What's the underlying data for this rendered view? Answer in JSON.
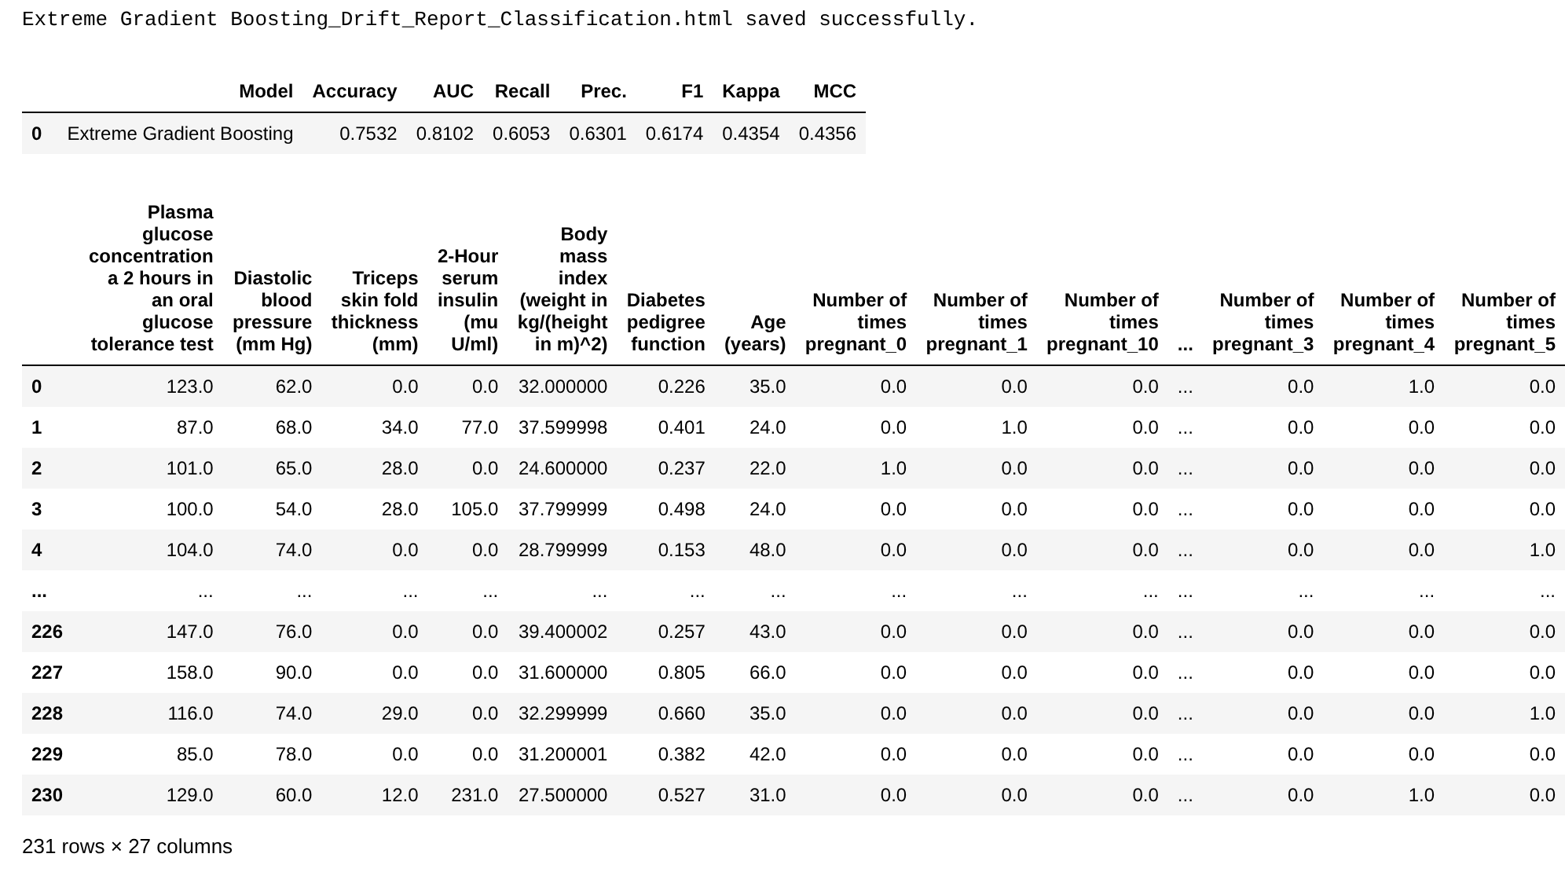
{
  "output_message": "Extreme Gradient Boosting_Drift_Report_Classification.html saved successfully.",
  "metrics_table": {
    "columns": [
      "Model",
      "Accuracy",
      "AUC",
      "Recall",
      "Prec.",
      "F1",
      "Kappa",
      "MCC"
    ],
    "rows": [
      {
        "index": "0",
        "cells": [
          "Extreme Gradient Boosting",
          "0.7532",
          "0.8102",
          "0.6053",
          "0.6301",
          "0.6174",
          "0.4354",
          "0.4356"
        ]
      }
    ]
  },
  "data_table": {
    "columns": [
      "Plasma glucose concentration a 2 hours in an oral glucose tolerance test",
      "Diastolic blood pressure (mm Hg)",
      "Triceps skin fold thickness (mm)",
      "2-Hour serum insulin (mu U/ml)",
      "Body mass index (weight in kg/(height in m)^2)",
      "Diabetes pedigree function",
      "Age (years)",
      "Number of times pregnant_0",
      "Number of times pregnant_1",
      "Number of times pregnant_10",
      "...",
      "Number of times pregnant_3",
      "Number of times pregnant_4",
      "Number of times pregnant_5"
    ],
    "rows": [
      {
        "index": "0",
        "cells": [
          "123.0",
          "62.0",
          "0.0",
          "0.0",
          "32.000000",
          "0.226",
          "35.0",
          "0.0",
          "0.0",
          "0.0",
          "...",
          "0.0",
          "1.0",
          "0.0"
        ]
      },
      {
        "index": "1",
        "cells": [
          "87.0",
          "68.0",
          "34.0",
          "77.0",
          "37.599998",
          "0.401",
          "24.0",
          "0.0",
          "1.0",
          "0.0",
          "...",
          "0.0",
          "0.0",
          "0.0"
        ]
      },
      {
        "index": "2",
        "cells": [
          "101.0",
          "65.0",
          "28.0",
          "0.0",
          "24.600000",
          "0.237",
          "22.0",
          "1.0",
          "0.0",
          "0.0",
          "...",
          "0.0",
          "0.0",
          "0.0"
        ]
      },
      {
        "index": "3",
        "cells": [
          "100.0",
          "54.0",
          "28.0",
          "105.0",
          "37.799999",
          "0.498",
          "24.0",
          "0.0",
          "0.0",
          "0.0",
          "...",
          "0.0",
          "0.0",
          "0.0"
        ]
      },
      {
        "index": "4",
        "cells": [
          "104.0",
          "74.0",
          "0.0",
          "0.0",
          "28.799999",
          "0.153",
          "48.0",
          "0.0",
          "0.0",
          "0.0",
          "...",
          "0.0",
          "0.0",
          "1.0"
        ]
      },
      {
        "index": "...",
        "cells": [
          "...",
          "...",
          "...",
          "...",
          "...",
          "...",
          "...",
          "...",
          "...",
          "...",
          "...",
          "...",
          "...",
          "..."
        ]
      },
      {
        "index": "226",
        "cells": [
          "147.0",
          "76.0",
          "0.0",
          "0.0",
          "39.400002",
          "0.257",
          "43.0",
          "0.0",
          "0.0",
          "0.0",
          "...",
          "0.0",
          "0.0",
          "0.0"
        ]
      },
      {
        "index": "227",
        "cells": [
          "158.0",
          "90.0",
          "0.0",
          "0.0",
          "31.600000",
          "0.805",
          "66.0",
          "0.0",
          "0.0",
          "0.0",
          "...",
          "0.0",
          "0.0",
          "0.0"
        ]
      },
      {
        "index": "228",
        "cells": [
          "116.0",
          "74.0",
          "29.0",
          "0.0",
          "32.299999",
          "0.660",
          "35.0",
          "0.0",
          "0.0",
          "0.0",
          "...",
          "0.0",
          "0.0",
          "1.0"
        ]
      },
      {
        "index": "229",
        "cells": [
          "85.0",
          "78.0",
          "0.0",
          "0.0",
          "31.200001",
          "0.382",
          "42.0",
          "0.0",
          "0.0",
          "0.0",
          "...",
          "0.0",
          "0.0",
          "0.0"
        ]
      },
      {
        "index": "230",
        "cells": [
          "129.0",
          "60.0",
          "12.0",
          "231.0",
          "27.500000",
          "0.527",
          "31.0",
          "0.0",
          "0.0",
          "0.0",
          "...",
          "0.0",
          "1.0",
          "0.0"
        ]
      }
    ]
  },
  "shape_note": "231 rows × 27 columns"
}
